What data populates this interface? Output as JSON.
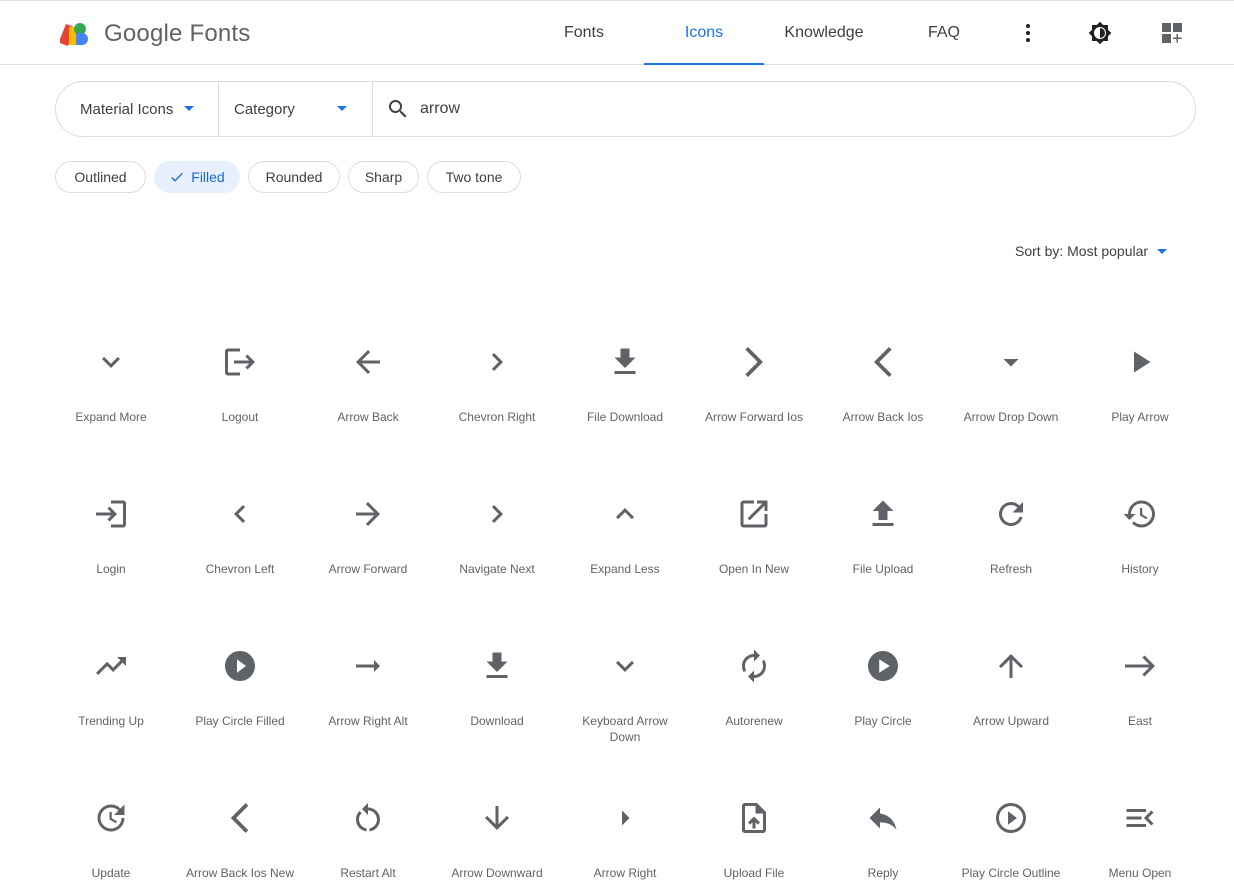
{
  "brand": {
    "name": "Google Fonts"
  },
  "nav": {
    "tabs": [
      {
        "label": "Fonts",
        "active": false
      },
      {
        "label": "Icons",
        "active": true
      },
      {
        "label": "Knowledge",
        "active": false
      },
      {
        "label": "FAQ",
        "active": false
      }
    ],
    "icons": [
      "more-vert-icon",
      "theme-toggle-icon",
      "apps-add-icon"
    ]
  },
  "search": {
    "family_dropdown": "Material Icons",
    "category_dropdown": "Category",
    "query": "arrow",
    "icon": "search-icon"
  },
  "styles": [
    {
      "label": "Outlined",
      "selected": false
    },
    {
      "label": "Filled",
      "selected": true
    },
    {
      "label": "Rounded",
      "selected": false
    },
    {
      "label": "Sharp",
      "selected": false
    },
    {
      "label": "Two tone",
      "selected": false
    }
  ],
  "sort": {
    "label": "Sort by: Most popular"
  },
  "colors": {
    "accent": "#1a73e8",
    "icon": "#5f6368",
    "chip_selected_bg": "#e8f0fe",
    "border": "#dadce0"
  },
  "icons": [
    {
      "label": "Expand More",
      "icon": "expand-more-icon"
    },
    {
      "label": "Logout",
      "icon": "logout-icon"
    },
    {
      "label": "Arrow Back",
      "icon": "arrow-back-icon"
    },
    {
      "label": "Chevron Right",
      "icon": "chevron-right-icon"
    },
    {
      "label": "File Download",
      "icon": "file-download-icon"
    },
    {
      "label": "Arrow Forward Ios",
      "icon": "arrow-forward-ios-icon"
    },
    {
      "label": "Arrow Back Ios",
      "icon": "arrow-back-ios-icon"
    },
    {
      "label": "Arrow Drop Down",
      "icon": "arrow-drop-down-icon"
    },
    {
      "label": "Play Arrow",
      "icon": "play-arrow-icon"
    },
    {
      "label": "Login",
      "icon": "login-icon"
    },
    {
      "label": "Chevron Left",
      "icon": "chevron-left-icon"
    },
    {
      "label": "Arrow Forward",
      "icon": "arrow-forward-icon"
    },
    {
      "label": "Navigate Next",
      "icon": "navigate-next-icon"
    },
    {
      "label": "Expand Less",
      "icon": "expand-less-icon"
    },
    {
      "label": "Open In New",
      "icon": "open-in-new-icon"
    },
    {
      "label": "File Upload",
      "icon": "file-upload-icon"
    },
    {
      "label": "Refresh",
      "icon": "refresh-icon"
    },
    {
      "label": "History",
      "icon": "history-icon"
    },
    {
      "label": "Trending Up",
      "icon": "trending-up-icon"
    },
    {
      "label": "Play Circle Filled",
      "icon": "play-circle-filled-icon"
    },
    {
      "label": "Arrow Right Alt",
      "icon": "arrow-right-alt-icon"
    },
    {
      "label": "Download",
      "icon": "download-icon"
    },
    {
      "label": "Keyboard Arrow Down",
      "icon": "keyboard-arrow-down-icon"
    },
    {
      "label": "Autorenew",
      "icon": "autorenew-icon"
    },
    {
      "label": "Play Circle",
      "icon": "play-circle-icon"
    },
    {
      "label": "Arrow Upward",
      "icon": "arrow-upward-icon"
    },
    {
      "label": "East",
      "icon": "east-icon"
    },
    {
      "label": "Update",
      "icon": "update-icon"
    },
    {
      "label": "Arrow Back Ios New",
      "icon": "arrow-back-ios-new-icon"
    },
    {
      "label": "Restart Alt",
      "icon": "restart-alt-icon"
    },
    {
      "label": "Arrow Downward",
      "icon": "arrow-downward-icon"
    },
    {
      "label": "Arrow Right",
      "icon": "arrow-right-icon"
    },
    {
      "label": "Upload File",
      "icon": "upload-file-icon"
    },
    {
      "label": "Reply",
      "icon": "reply-icon"
    },
    {
      "label": "Play Circle Outline",
      "icon": "play-circle-outline-icon"
    },
    {
      "label": "Menu Open",
      "icon": "menu-open-icon"
    }
  ]
}
